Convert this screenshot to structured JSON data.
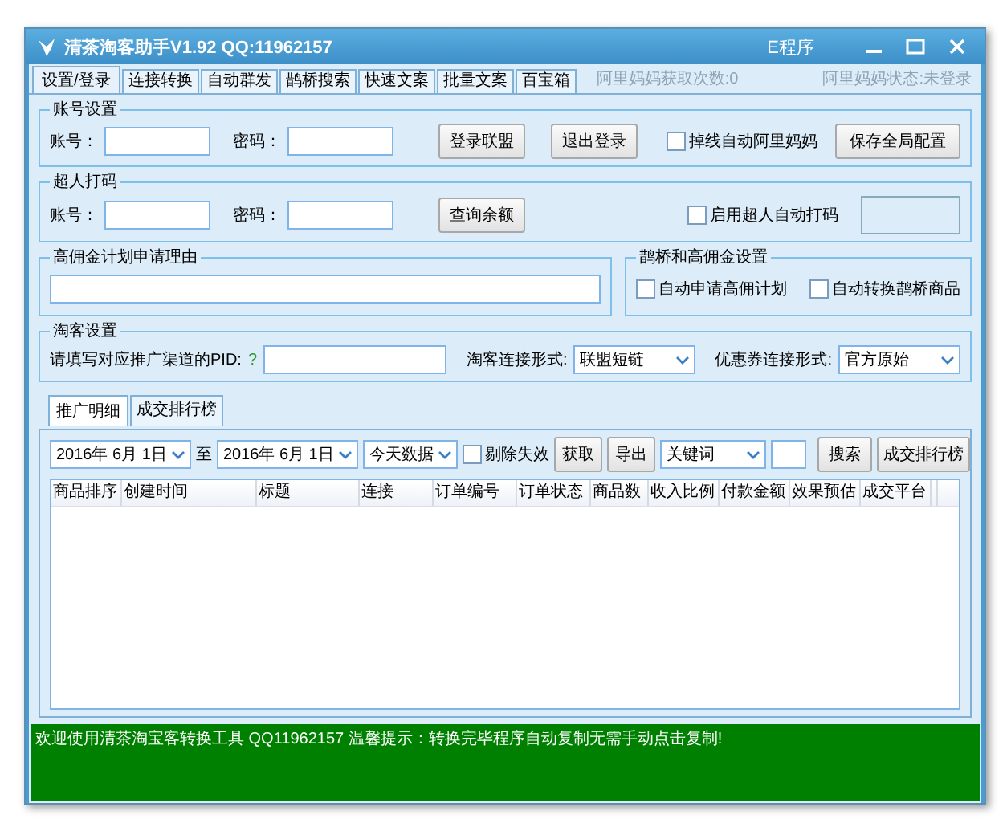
{
  "window": {
    "title": "清茶淘客助手V1.92 QQ:11962157",
    "menu": "E程序"
  },
  "tabs": [
    {
      "label": "设置/登录",
      "selected": true
    },
    {
      "label": "连接转换",
      "selected": false
    },
    {
      "label": "自动群发",
      "selected": false
    },
    {
      "label": "鹊桥搜索",
      "selected": false
    },
    {
      "label": "快速文案",
      "selected": false
    },
    {
      "label": "批量文案",
      "selected": false
    },
    {
      "label": "百宝箱",
      "selected": false
    }
  ],
  "status_texts": [
    "阿里妈妈获取次数:0",
    "阿里妈妈状态:未登录"
  ],
  "account_group": {
    "title": "账号设置",
    "fields": [
      {
        "label": "账号："
      },
      {
        "label": "密码："
      }
    ],
    "buttons": [
      "登录联盟",
      "退出登录"
    ],
    "checkbox": {
      "label": "掉线自动阿里妈妈",
      "checked": false
    },
    "save_button": "保存全局配置"
  },
  "captcha_group": {
    "title": "超人打码",
    "fields": [
      {
        "label": "账号："
      },
      {
        "label": "密码："
      }
    ],
    "buttons": [
      "查询余额"
    ],
    "checkbox": {
      "label": "启用超人自动打码",
      "checked": false
    }
  },
  "reason_group": {
    "title": "高佣金计划申请理由"
  },
  "bridge_group": {
    "title": "鹊桥和高佣金设置",
    "checkboxes": [
      {
        "label": "自动申请高佣计划",
        "checked": false
      },
      {
        "label": "自动转换鹊桥商品",
        "checked": false
      }
    ]
  },
  "taoke_group": {
    "title": "淘客设置",
    "pid_label": "请填写对应推广渠道的PID:",
    "help": "?",
    "selects": [
      {
        "label": "淘客连接形式:",
        "value": "联盟短链"
      },
      {
        "label": "优惠券连接形式:",
        "value": "官方原始"
      }
    ]
  },
  "sub_tabs": [
    {
      "label": "推广明细",
      "selected": true
    },
    {
      "label": "成交排行榜",
      "selected": false
    }
  ],
  "filters": {
    "date_from": "2016年 6月 1日",
    "to": "至",
    "date_to": "2016年 6月 1日",
    "range": "今天数据",
    "exclude": {
      "label": "剔除失效",
      "checked": false
    },
    "buttons": [
      "获取",
      "导出"
    ],
    "keyword_type": "关键词",
    "search_button": "搜索",
    "rank_button": "成交排行榜"
  },
  "table": {
    "columns": [
      "商品排序",
      "创建时间",
      "标题",
      "连接",
      "订单编号",
      "订单状态",
      "商品数",
      "收入比例",
      "付款金额",
      "效果预估",
      "成交平台"
    ]
  },
  "status_bar": {
    "text": "欢迎使用清茶淘宝客转换工具 QQ11962157  温馨提示：转换完毕程序自动复制无需手动点击复制!"
  }
}
